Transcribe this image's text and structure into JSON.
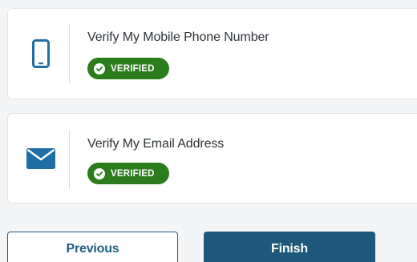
{
  "verifications": [
    {
      "title": "Verify My Mobile Phone Number",
      "icon": "mobile-phone-icon",
      "status": "VERIFIED"
    },
    {
      "title": "Verify My Email Address",
      "icon": "envelope-icon",
      "status": "VERIFIED"
    }
  ],
  "buttons": {
    "previous_label": "Previous",
    "finish_label": "Finish"
  },
  "colors": {
    "icon_blue": "#1f6fa6",
    "verified_green": "#2a7d1a",
    "button_navy": "#1d5779"
  }
}
